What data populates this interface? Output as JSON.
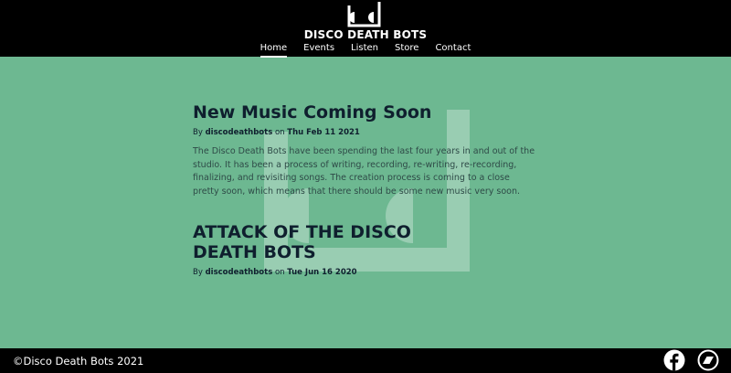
{
  "header": {
    "site_title": "DISCO DEATH BOTS",
    "logo_icon": "disco-death-bots-logo",
    "nav": [
      {
        "label": "Home",
        "active": true
      },
      {
        "label": "Events",
        "active": false
      },
      {
        "label": "Listen",
        "active": false
      },
      {
        "label": "Store",
        "active": false
      },
      {
        "label": "Contact",
        "active": false
      }
    ]
  },
  "posts": [
    {
      "title": "New Music Coming Soon",
      "by": "By",
      "author": "discodeathbots",
      "on": "on",
      "date": "Thu Feb 11 2021",
      "excerpt": "The Disco Death Bots have been spending the last four years in and out of the studio. It has been a process of writing, recording, re-writing, re-recording, finalizing, and revisiting songs. The creation process is coming to a close pretty soon, which means that there should be some new music very soon."
    },
    {
      "title": "ATTACK OF THE DISCO DEATH BOTS",
      "by": "By",
      "author": "discodeathbots",
      "on": "on",
      "date": "Tue Jun 16 2020"
    }
  ],
  "footer": {
    "copyright": "©Disco Death Bots 2021",
    "social": [
      {
        "icon": "facebook-icon"
      },
      {
        "icon": "bandcamp-icon"
      }
    ]
  },
  "colors": {
    "background": "#6db891",
    "header_bg": "#000000",
    "title_text": "#0f1f2e"
  }
}
